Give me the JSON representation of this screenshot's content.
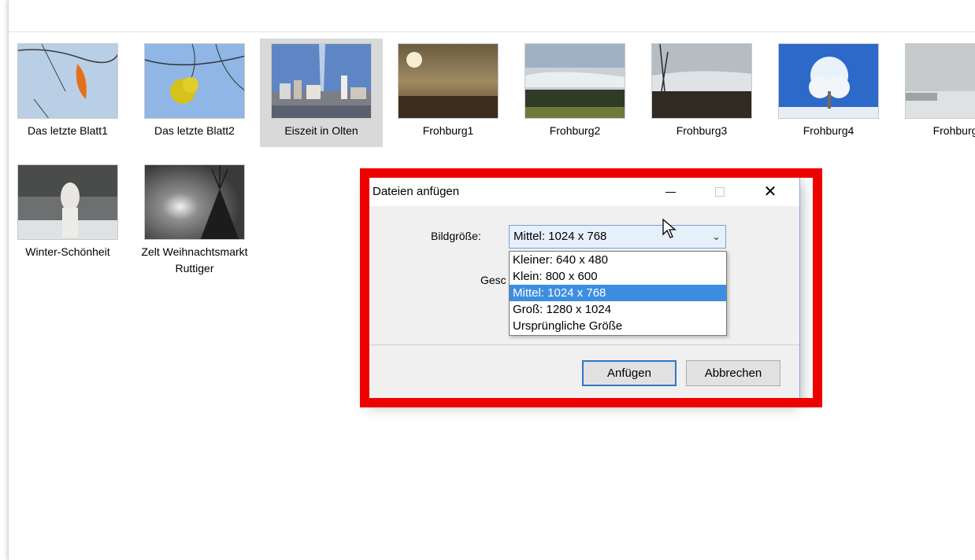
{
  "files": [
    {
      "label": "Das letzte Blatt1"
    },
    {
      "label": "Das letzte Blatt2"
    },
    {
      "label": "Eiszeit in Olten"
    },
    {
      "label": "Frohburg1"
    },
    {
      "label": "Frohburg2"
    },
    {
      "label": "Frohburg3"
    },
    {
      "label": "Frohburg4"
    },
    {
      "label": "Frohburg"
    },
    {
      "label": "Winter-Schönheit"
    },
    {
      "label": "Zelt Weihnachtsmarkt Ruttiger"
    }
  ],
  "dialog": {
    "title": "Dateien anfügen",
    "size_label": "Bildgröße:",
    "truncated_label": "Gesc",
    "selected_size": "Mittel: 1024 x 768",
    "options": [
      "Kleiner: 640 x 480",
      "Klein: 800 x 600",
      "Mittel: 1024 x 768",
      "Groß: 1280 x 1024",
      "Ursprüngliche Größe"
    ],
    "attach_button": "Anfügen",
    "cancel_button": "Abbrechen"
  },
  "colors": {
    "highlight_frame": "#ee0000",
    "selection_blue": "#3d8ee0"
  }
}
